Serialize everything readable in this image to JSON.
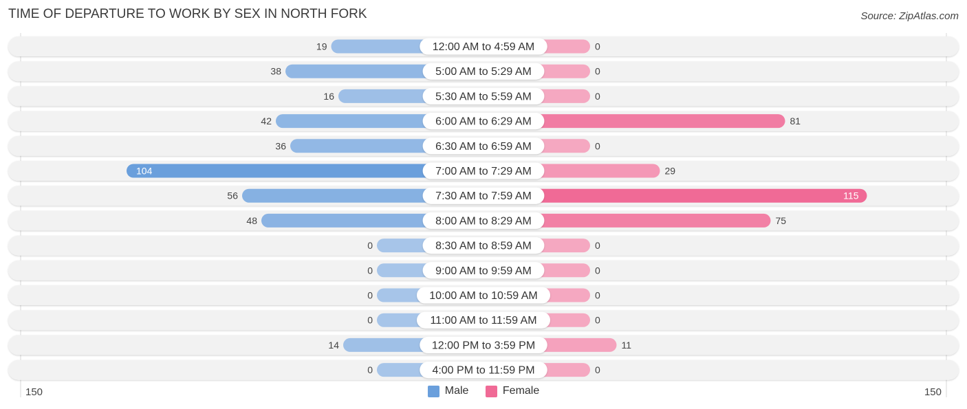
{
  "title": "TIME OF DEPARTURE TO WORK BY SEX IN NORTH FORK",
  "source": "Source: ZipAtlas.com",
  "colors": {
    "male": "#6a9fdc",
    "male_light": "#a7c5e9",
    "female": "#f06a96",
    "female_light": "#f5a8c1",
    "row_bg": "#f2f2f2"
  },
  "chart_data": {
    "type": "bar",
    "orientation": "horizontal-diverging",
    "title": "TIME OF DEPARTURE TO WORK BY SEX IN NORTH FORK",
    "categories": [
      "12:00 AM to 4:59 AM",
      "5:00 AM to 5:29 AM",
      "5:30 AM to 5:59 AM",
      "6:00 AM to 6:29 AM",
      "6:30 AM to 6:59 AM",
      "7:00 AM to 7:29 AM",
      "7:30 AM to 7:59 AM",
      "8:00 AM to 8:29 AM",
      "8:30 AM to 8:59 AM",
      "9:00 AM to 9:59 AM",
      "10:00 AM to 10:59 AM",
      "11:00 AM to 11:59 AM",
      "12:00 PM to 3:59 PM",
      "4:00 PM to 11:59 PM"
    ],
    "series": [
      {
        "name": "Male",
        "values": [
          19,
          38,
          16,
          42,
          36,
          104,
          56,
          48,
          0,
          0,
          0,
          0,
          14,
          0
        ]
      },
      {
        "name": "Female",
        "values": [
          0,
          0,
          0,
          81,
          0,
          29,
          115,
          75,
          0,
          0,
          0,
          0,
          11,
          0
        ]
      }
    ],
    "axis_min_label": "150",
    "axis_max_label": "150",
    "xlim": [
      -150,
      150
    ],
    "legend": [
      "Male",
      "Female"
    ],
    "legend_position": "bottom-center"
  }
}
